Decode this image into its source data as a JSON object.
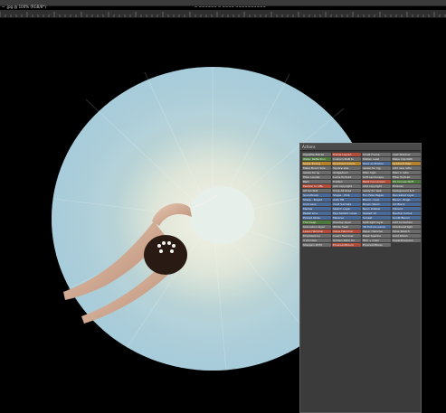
{
  "window": {
    "doc_tab": "~ .jpg @ 100% (RGB/8*)",
    "title_center": "~ ~~~~~~ ~ ~~~~ ~~~~~~~~~~"
  },
  "actions_panel": {
    "title": "Actions",
    "buttons": [
      {
        "label": "Vignette Extras",
        "color": "#6b6b6b"
      },
      {
        "label": "Frame Layout",
        "color": "#b24c3b"
      },
      {
        "label": "Small Frame",
        "color": "#6b6b6b"
      },
      {
        "label": "Cast Shadow",
        "color": "#6b6b6b"
      },
      {
        "label": "Water Reflection",
        "color": "#4f7a3e"
      },
      {
        "label": "Custom RGB to",
        "color": "#6b6b6b"
      },
      {
        "label": "Molten Lead",
        "color": "#6b6b6b"
      },
      {
        "label": "Make Clip Path",
        "color": "#6b6b6b"
      },
      {
        "label": "Sepia Toning",
        "color": "#b5842a"
      },
      {
        "label": "Quadrant Colors",
        "color": "#b5842a"
      },
      {
        "label": "Save as Photos",
        "color": "#4a6a99"
      },
      {
        "label": "Gradient Map",
        "color": "#b5842a"
      },
      {
        "label": "Make Brush Size",
        "color": "#6b6b6b"
      },
      {
        "label": "Square size",
        "color": "#6b6b6b"
      },
      {
        "label": "resize for hig",
        "color": "#6b6b6b"
      },
      {
        "label": "Add new ratio",
        "color": "#6b6b6b"
      },
      {
        "label": "resize for ig",
        "color": "#6b6b6b"
      },
      {
        "label": "dodge/burn",
        "color": "#6b6b6b"
      },
      {
        "label": "filter high",
        "color": "#6b6b6b"
      },
      {
        "label": "filter 2 ratio",
        "color": "#6b6b6b"
      },
      {
        "label": "Filter Landsc",
        "color": "#6b6b6b"
      },
      {
        "label": "Luma Portrait",
        "color": "#6b6b6b"
      },
      {
        "label": "Soft Landscape",
        "color": "#6b6b6b"
      },
      {
        "label": "Filter Portrait",
        "color": "#6b6b6b"
      },
      {
        "label": "B&D",
        "color": "#6b6b6b"
      },
      {
        "label": "Frattan",
        "color": "#6b6b6b"
      },
      {
        "label": "B&W Conversion",
        "color": "#b24c3b"
      },
      {
        "label": "HS Curves Shift",
        "color": "#4f7a3e"
      },
      {
        "label": "Fashion to UBL",
        "color": "#b24c3b"
      },
      {
        "label": "Add copyright",
        "color": "#6b6b6b"
      },
      {
        "label": "Add copyright",
        "color": "#6b6b6b"
      },
      {
        "label": "Emboss",
        "color": "#6b6b6b"
      },
      {
        "label": "Art Go SLR",
        "color": "#6b6b6b"
      },
      {
        "label": "Crisp All Area",
        "color": "#6b6b6b"
      },
      {
        "label": "ready for web",
        "color": "#6b6b6b"
      },
      {
        "label": "background & K",
        "color": "#6b6b6b"
      },
      {
        "label": "Soundtrack",
        "color": "#4a6a99"
      },
      {
        "label": "Shape - Pink",
        "color": "#4a6a99"
      },
      {
        "label": "Fun Fake Pages",
        "color": "#4a6a99"
      },
      {
        "label": "Recreated layer",
        "color": "#4a6a99"
      },
      {
        "label": "Sharp - Bright",
        "color": "#4a6a99"
      },
      {
        "label": "Auto HB",
        "color": "#4a6a99"
      },
      {
        "label": "Blend - Cool",
        "color": "#4a6a99"
      },
      {
        "label": "Blend - Brigh",
        "color": "#4a6a99"
      },
      {
        "label": "Cold Lens",
        "color": "#4a6a99"
      },
      {
        "label": "Vivid Sachets",
        "color": "#4a6a99"
      },
      {
        "label": "Brown Warm",
        "color": "#4a6a99"
      },
      {
        "label": "Art Black",
        "color": "#4a6a99"
      },
      {
        "label": "Marble",
        "color": "#4a6a99"
      },
      {
        "label": "Sketch Layer",
        "color": "#4a6a99"
      },
      {
        "label": "Neon Rubber",
        "color": "#4a6a99"
      },
      {
        "label": "Vibrant",
        "color": "#4a6a99"
      },
      {
        "label": "Pastel Line",
        "color": "#4a6a99"
      },
      {
        "label": "Psychedelic Lines",
        "color": "#4a6a99"
      },
      {
        "label": "Glazed 12",
        "color": "#4a6a99"
      },
      {
        "label": "Neutral Colour",
        "color": "#4a6a99"
      },
      {
        "label": "Pinned Glide",
        "color": "#4a6a99"
      },
      {
        "label": "Minerva",
        "color": "#4a6a99"
      },
      {
        "label": "Sunset",
        "color": "#4a6a99"
      },
      {
        "label": "Sunlit Bloom",
        "color": "#4a6a99"
      },
      {
        "label": "The Deep",
        "color": "#4f7a3e"
      },
      {
        "label": "Overlay layer",
        "color": "#6b6b6b"
      },
      {
        "label": "Split light layer",
        "color": "#6b6b6b"
      },
      {
        "label": "Add Correction",
        "color": "#6b6b6b"
      },
      {
        "label": "Saturation layer",
        "color": "#6b6b6b"
      },
      {
        "label": "White fresh",
        "color": "#6b6b6b"
      },
      {
        "label": "3D Picture panel",
        "color": "#4a6a99"
      },
      {
        "label": "Shadows/Highl",
        "color": "#6b6b6b"
      },
      {
        "label": "Lasso Hammer",
        "color": "#b24c3b"
      },
      {
        "label": "Value Hammer",
        "color": "#b24c3b"
      },
      {
        "label": "Paper Hammer",
        "color": "#6b6b6b"
      },
      {
        "label": "False Sketch",
        "color": "#6b6b6b"
      },
      {
        "label": "Emphasis by",
        "color": "#6b6b6b"
      },
      {
        "label": "Invert Hammer",
        "color": "#6b6b6b"
      },
      {
        "label": "Mask Sparkle",
        "color": "#6b6b6b"
      },
      {
        "label": "Gold Polish",
        "color": "#6b6b6b"
      },
      {
        "label": "3 All Color",
        "color": "#6b6b6b"
      },
      {
        "label": "Golden Ratio tin",
        "color": "#6b6b6b"
      },
      {
        "label": "Film + Color",
        "color": "#6b6b6b"
      },
      {
        "label": "Supersharpens",
        "color": "#6b6b6b"
      },
      {
        "label": "Sharpen 2070",
        "color": "#6b6b6b"
      },
      {
        "label": "Emerald Bloom",
        "color": "#b24c3b"
      },
      {
        "label": "Emerald Blues",
        "color": "#6b6b6b"
      },
      {
        "label": "",
        "color": "#3b3b3b"
      }
    ]
  }
}
